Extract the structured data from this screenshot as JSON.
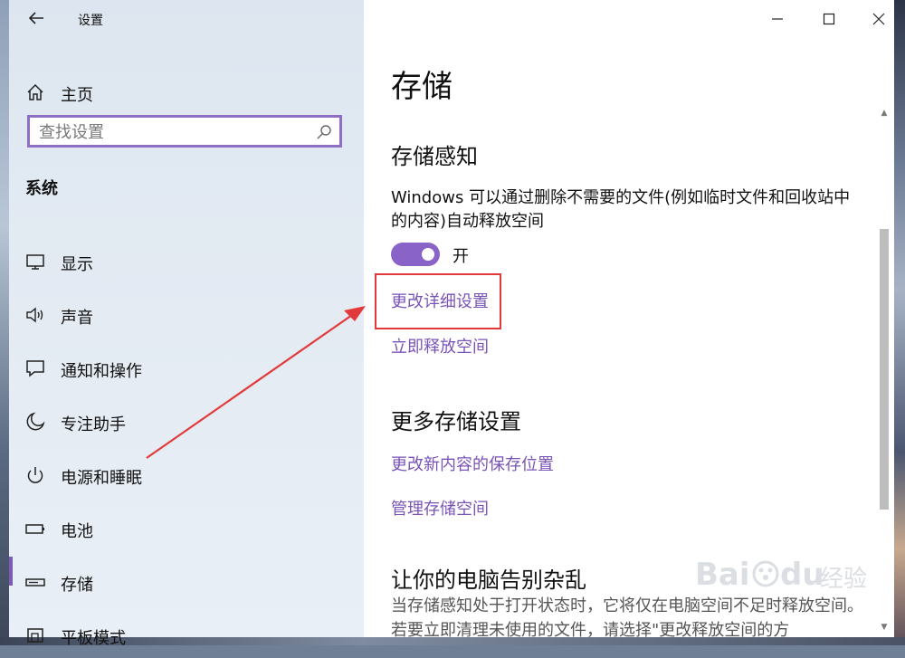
{
  "window": {
    "app_title": "设置",
    "controls": [
      "minimize-icon",
      "maximize-icon",
      "close-icon"
    ]
  },
  "sidebar": {
    "home_label": "主页",
    "search": {
      "placeholder": "查找设置"
    },
    "section_title": "系统",
    "items": [
      {
        "label": "显示",
        "icon": "monitor-icon"
      },
      {
        "label": "声音",
        "icon": "speaker-icon"
      },
      {
        "label": "通知和操作",
        "icon": "notification-icon"
      },
      {
        "label": "专注助手",
        "icon": "moon-icon"
      },
      {
        "label": "电源和睡眠",
        "icon": "power-icon"
      },
      {
        "label": "电池",
        "icon": "battery-icon"
      },
      {
        "label": "存储",
        "icon": "storage-icon",
        "selected": true
      },
      {
        "label": "平板模式",
        "icon": "tablet-icon"
      }
    ]
  },
  "main": {
    "page_title": "存储",
    "storage_sense": {
      "heading": "存储感知",
      "description": "Windows 可以通过删除不需要的文件(例如临时文件和回收站中的内容)自动释放空间",
      "toggle_state": "开",
      "toggle_on": true,
      "link_change_settings": "更改详细设置",
      "link_free_space": "立即释放空间"
    },
    "more_settings": {
      "heading": "更多存储设置",
      "link_save_location": "更改新内容的保存位置",
      "link_manage": "管理存储空间"
    },
    "declutter": {
      "heading": "让你的电脑告别杂乱",
      "text": "当存储感知处于打开状态时，它将仅在电脑空间不足时释放空间。若要立即清理未使用的文件，请选择\"更改释放空间的方"
    }
  },
  "annotation": {
    "highlight_color": "#e23a3a"
  },
  "watermark": {
    "text": "Bai du 经验"
  },
  "colors": {
    "accent": "#7a53b7",
    "toggle": "#8a63c8",
    "search_border": "#8e6fc6"
  }
}
